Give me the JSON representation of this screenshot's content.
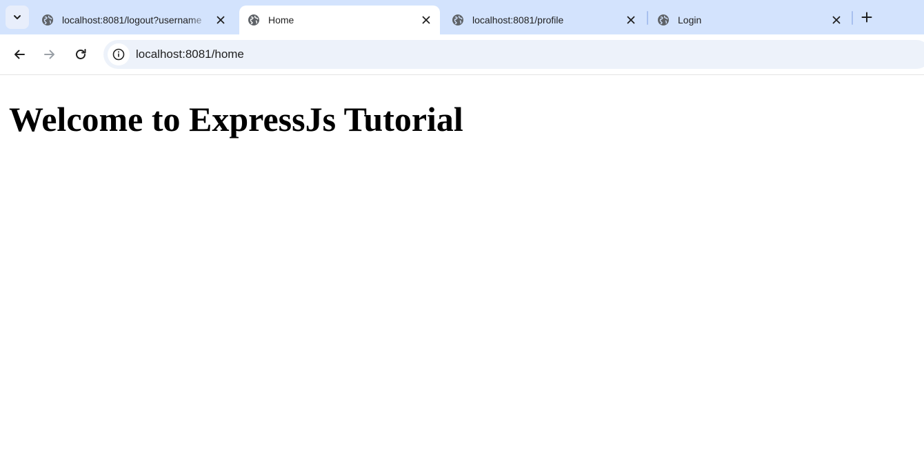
{
  "browser": {
    "tab_search_icon": "chevron-down-icon",
    "tabs": [
      {
        "title": "localhost:8081/logout?username",
        "favicon": "globe-icon",
        "active": false
      },
      {
        "title": "Home",
        "favicon": "globe-icon",
        "active": true
      },
      {
        "title": "localhost:8081/profile",
        "favicon": "globe-icon",
        "active": false
      },
      {
        "title": "Login",
        "favicon": "globe-icon",
        "active": false
      }
    ],
    "new_tab_icon": "plus-icon",
    "toolbar": {
      "back_icon": "arrow-left-icon",
      "forward_icon": "arrow-right-icon",
      "reload_icon": "reload-icon",
      "site_info_icon": "info-icon",
      "url": "localhost:8081/home"
    },
    "colors": {
      "tabstrip": "#d3e3fd",
      "omnibox": "#edf2fa",
      "active_tab": "#ffffff"
    }
  },
  "page": {
    "heading": "Welcome to ExpressJs Tutorial"
  }
}
